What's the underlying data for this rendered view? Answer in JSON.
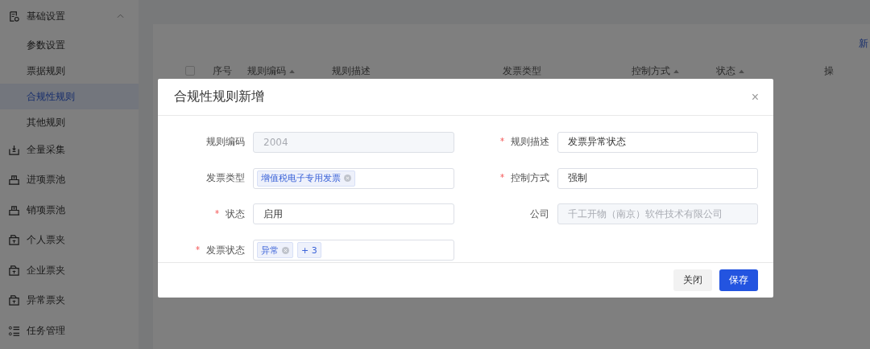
{
  "sidebar": {
    "items": [
      {
        "label": "基础设置",
        "expanded": true,
        "children": [
          {
            "label": "参数设置",
            "selected": false
          },
          {
            "label": "票据规则",
            "selected": false
          },
          {
            "label": "合规性规则",
            "selected": true
          },
          {
            "label": "其他规则",
            "selected": false
          }
        ]
      },
      {
        "label": "全量采集"
      },
      {
        "label": "进项票池"
      },
      {
        "label": "销项票池"
      },
      {
        "label": "个人票夹"
      },
      {
        "label": "企业票夹"
      },
      {
        "label": "异常票夹"
      },
      {
        "label": "任务管理"
      }
    ]
  },
  "toolbar": {
    "new_button": "新"
  },
  "table": {
    "select_all": {
      "checked": false
    },
    "columns": [
      {
        "label": "序号"
      },
      {
        "label": "规则编码",
        "sortable": true
      },
      {
        "label": "规则描述"
      },
      {
        "label": "发票类型"
      },
      {
        "label": "控制方式",
        "sortable": true
      },
      {
        "label": "状态",
        "sortable": true
      },
      {
        "label": "操"
      }
    ]
  },
  "dialog": {
    "title": "合规性规则新增",
    "close": "×",
    "fields": [
      {
        "label": "规则编码",
        "required": false,
        "kind": "disabled",
        "value": "2004"
      },
      {
        "label": "规则描述",
        "required": true,
        "kind": "input",
        "value": "发票异常状态"
      },
      {
        "label": "发票类型",
        "required": false,
        "kind": "tags",
        "tags": [
          {
            "label": "增值税电子专用发票",
            "closable": true
          }
        ]
      },
      {
        "label": "控制方式",
        "required": true,
        "kind": "input",
        "value": "强制"
      },
      {
        "label": "状态",
        "required": true,
        "kind": "input",
        "value": "启用"
      },
      {
        "label": "公司",
        "required": false,
        "kind": "disabled",
        "value": "千工开物（南京）软件技术有限公司"
      },
      {
        "label": "发票状态",
        "required": true,
        "kind": "tags",
        "tags": [
          {
            "label": "异常",
            "closable": true
          },
          {
            "label": "+ 3",
            "closable": false
          }
        ]
      }
    ],
    "buttons": [
      {
        "label": "关闭",
        "kind": "default"
      },
      {
        "label": "保存",
        "kind": "primary"
      }
    ]
  }
}
